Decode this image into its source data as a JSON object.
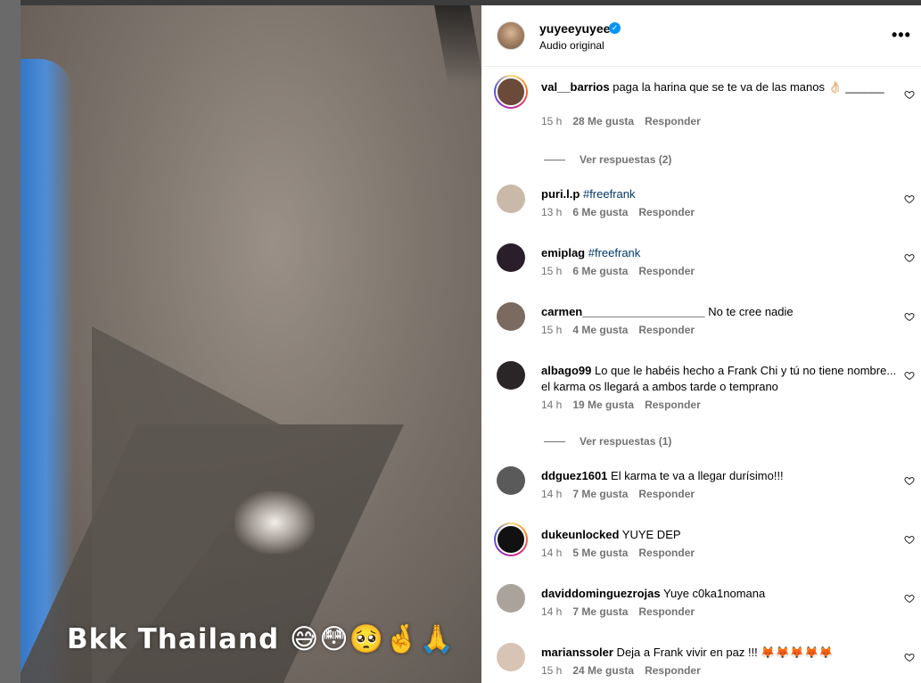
{
  "video": {
    "caption": "Bkk Thailand 😅😳🥺🤞🙏"
  },
  "header": {
    "username": "yuyeeyuyee",
    "verified_mark": "✓",
    "subtitle": "Audio original",
    "more_label": "•••"
  },
  "comments": [
    {
      "user": "val__barrios",
      "text": " paga la harina que se te va de las manos 👌🏻 ______",
      "time": "15 h",
      "likes": "28 Me gusta",
      "reply": "Responder",
      "view_replies": "Ver respuestas (2)",
      "avatar_color": "#6b4a3a",
      "story_ring": true
    },
    {
      "user": "puri.l.p",
      "tag": "#freefrank",
      "time": "13 h",
      "likes": "6 Me gusta",
      "reply": "Responder",
      "avatar_color": "#c9b9a8"
    },
    {
      "user": "emiplag",
      "tag": "#freefrank",
      "time": "15 h",
      "likes": "6 Me gusta",
      "reply": "Responder",
      "avatar_color": "#2a1e2a"
    },
    {
      "user": "carmen___________________",
      "text": " No te cree nadie",
      "time": "15 h",
      "likes": "4 Me gusta",
      "reply": "Responder",
      "avatar_color": "#7a6a60"
    },
    {
      "user": "albago99",
      "text": " Lo que le habéis hecho a Frank Chi y tú no tiene nombre... el karma os llegará a ambos tarde o temprano",
      "time": "14 h",
      "likes": "19 Me gusta",
      "reply": "Responder",
      "view_replies": "Ver respuestas (1)",
      "avatar_color": "#2a2526"
    },
    {
      "user": "ddguez1601",
      "text": " El karma te va a llegar durísimo!!!",
      "time": "14 h",
      "likes": "7 Me gusta",
      "reply": "Responder",
      "avatar_color": "#5a5a5a"
    },
    {
      "user": "dukeunlocked",
      "text": " YUYE DEP",
      "time": "14 h",
      "likes": "5 Me gusta",
      "reply": "Responder",
      "avatar_color": "#111111",
      "story_ring": true
    },
    {
      "user": "daviddominguezrojas",
      "text": " Yuye c0ka1nomana",
      "time": "14 h",
      "likes": "7 Me gusta",
      "reply": "Responder",
      "avatar_color": "#a9a39c"
    },
    {
      "user": "marianssoler",
      "text": " Deja a Frank vivir en paz !!! 🦊🦊🦊🦊🦊",
      "time": "15 h",
      "likes": "24 Me gusta",
      "reply": "Responder",
      "avatar_color": "#d8c4b4"
    }
  ]
}
